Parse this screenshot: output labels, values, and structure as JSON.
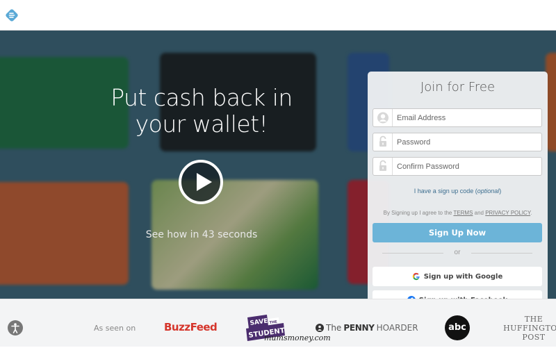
{
  "header": {
    "logo_icon": "ebates-logo-icon"
  },
  "hero": {
    "headline": "Put cash back in your wallet!",
    "video_caption": "See how in 43 seconds",
    "play_icon": "play-icon",
    "background_cards": [
      "starbucks-green",
      "amazon-black",
      "nike-orange",
      "starbucks-swirl"
    ]
  },
  "signup": {
    "title": "Join for Free",
    "email_placeholder": "Email Address",
    "password_placeholder": "Password",
    "confirm_placeholder": "Confirm Password",
    "code_link_prefix": "I have a sign up code (",
    "code_link_optional": "optional",
    "code_link_suffix": ")",
    "terms_prefix": "By Signing up I agree to the ",
    "terms_link": "TERMS",
    "terms_and": " and ",
    "privacy_link": "PRIVACY POLICY",
    "terms_suffix": ".",
    "submit_label": "Sign Up Now",
    "or_label": "or",
    "google_label": "Sign up with Google",
    "facebook_label": "Sign up with Facebook",
    "accent_color": "#6cb4d8"
  },
  "footer": {
    "as_seen_on": "As seen on",
    "logos": {
      "buzzfeed": "BuzzFeed",
      "save_the_student_1": "SAVE",
      "save_the_student_2": "THE",
      "save_the_student_3": "STUDENT!",
      "penny_the": "The",
      "penny_penny": "PENNY",
      "penny_hoarder": "HOARDER",
      "abc": "abc",
      "huff_1": "THE",
      "huff_2": "HUFFINGTON",
      "huff_3": "POST"
    },
    "watermark": "mumsmoney.com"
  }
}
